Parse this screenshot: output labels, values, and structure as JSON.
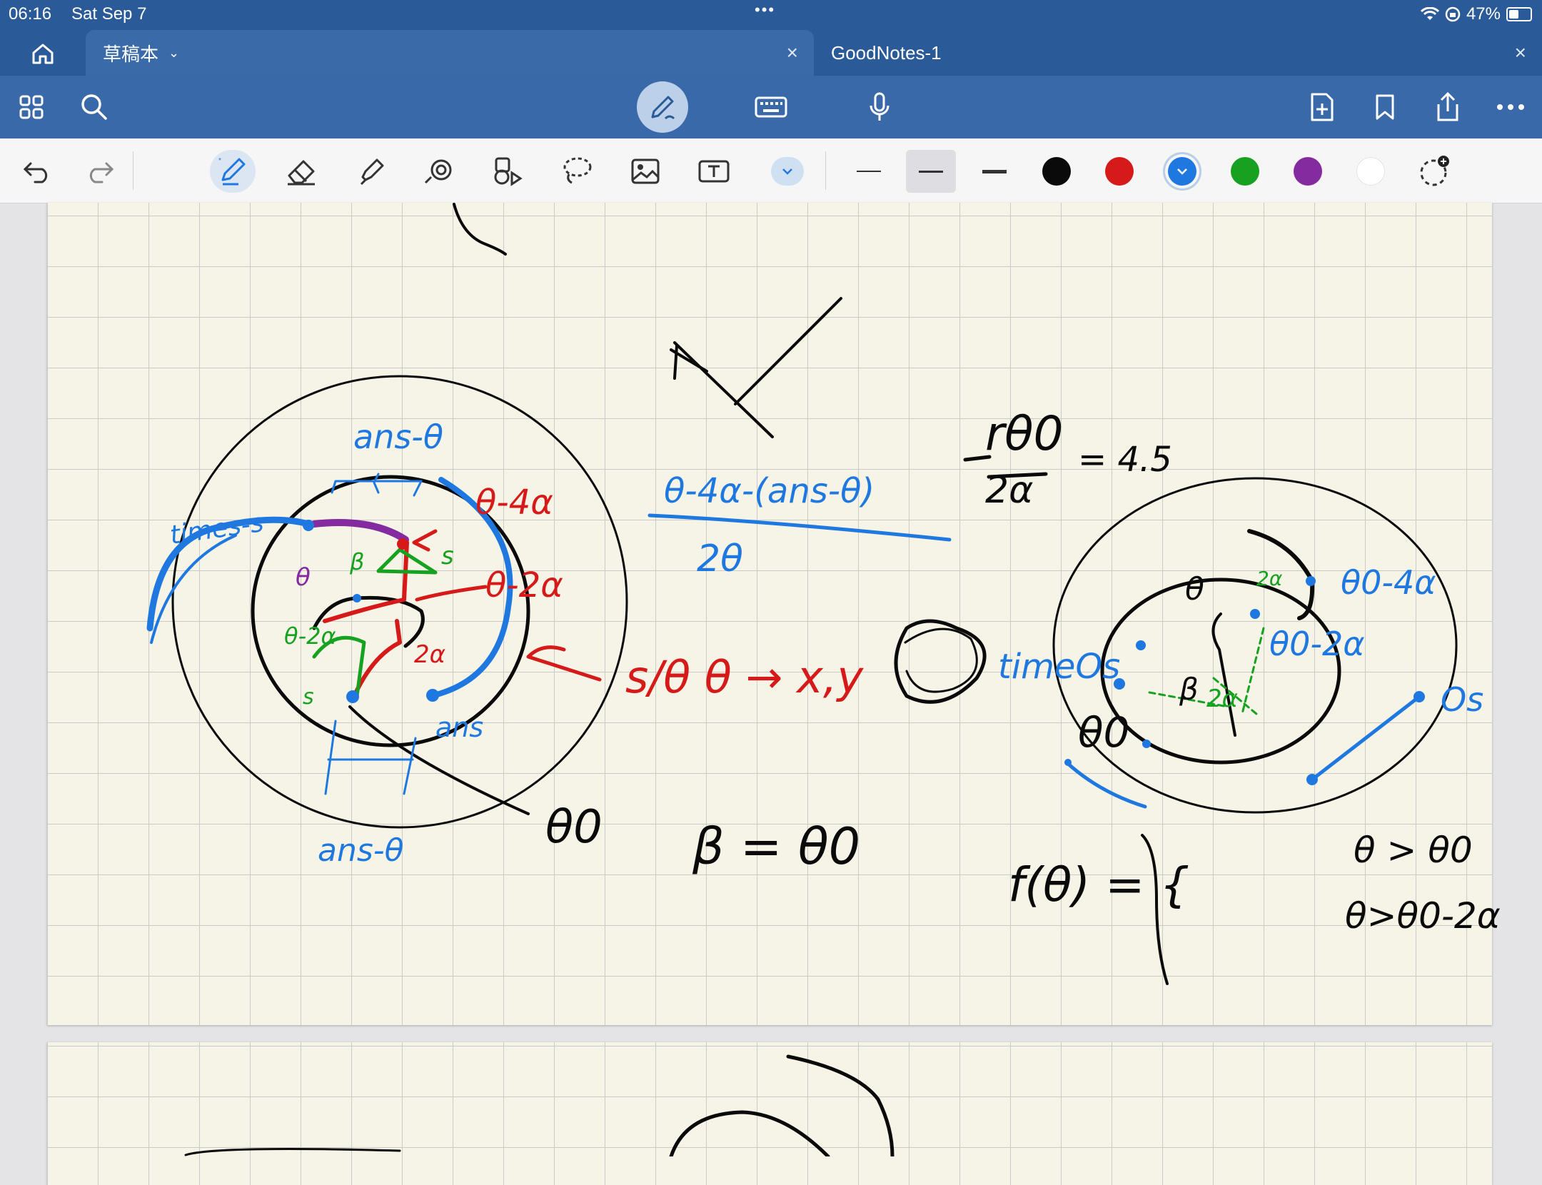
{
  "status": {
    "time": "06:16",
    "date": "Sat Sep 7",
    "dots": "•••",
    "battery": "47%"
  },
  "tabs": [
    {
      "label": "草稿本",
      "active": true
    },
    {
      "label": "GoodNotes-1",
      "active": false
    }
  ],
  "toolbar": {
    "selected_tool": "pen",
    "selected_color": "blue"
  },
  "colors": {
    "black": "#0a0a0a",
    "red": "#d61a1a",
    "blue": "#1f78e0",
    "green": "#16a120",
    "purple": "#842ba0",
    "white": "#ffffff"
  },
  "notes": {
    "left_top": "ans-θ",
    "left_bottom": "ans-θ",
    "left_times": "times-s",
    "left_ans": "ans",
    "left_theta": "θ",
    "left_beta": "β",
    "left_s1": "s",
    "left_s2": "s",
    "left_4a": "θ-4α",
    "left_2a_outer": "θ-2α",
    "left_2a_inner": "2α",
    "left_theta_red": "θ-2α",
    "theta0_mid": "θ0",
    "mid_red": "s/θ θ → x,y",
    "fraction_top": "θ-4α-(ans-θ)",
    "fraction_bottom": "2θ",
    "formula_top": "rθ0",
    "formula_den": "2α",
    "formula_val": "= 4.5",
    "beta_eq": "β = θ0",
    "f_theta": "f(θ) = {",
    "cond1": "θ > θ0",
    "cond2": "θ>θ0-2α",
    "right_theta": "θ",
    "right_4a": "θ0-4α",
    "right_2a": "θ0-2α",
    "right_times": "timeOs",
    "right_theta0": "θ0",
    "right_os": "Os",
    "right_beta": "β",
    "right_2a_green": "2α",
    "right_2a_green2": "2α"
  }
}
